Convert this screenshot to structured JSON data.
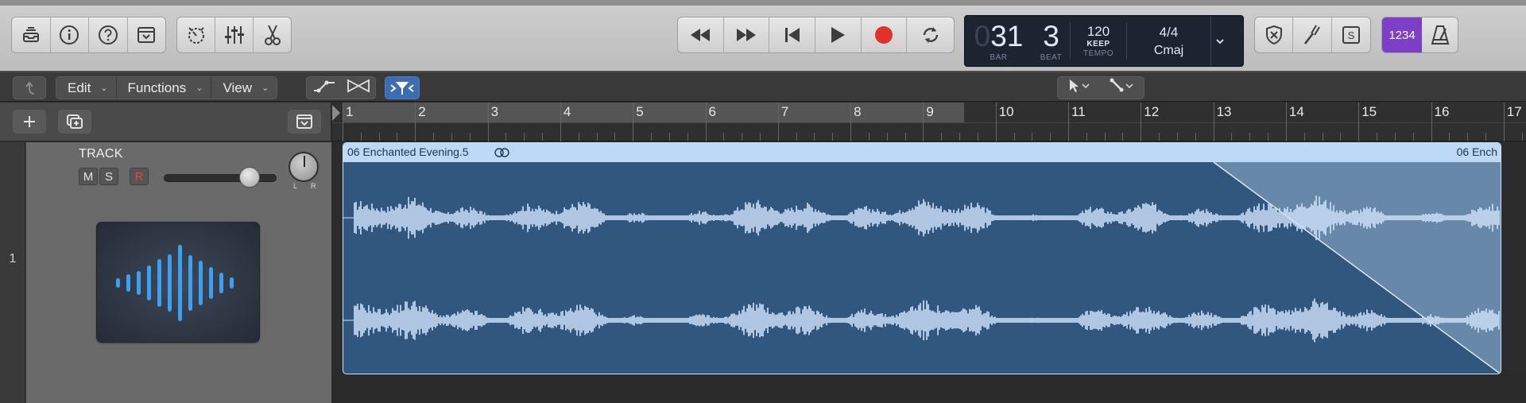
{
  "control_bar": {
    "left_buttons": [
      "library-icon",
      "info-icon",
      "help-icon",
      "toolbar-icon"
    ],
    "mid_buttons": [
      "smart-controls-icon",
      "mixer-icon",
      "editors-scissors-icon"
    ],
    "transport": [
      "rewind-icon",
      "fast-forward-icon",
      "go-to-beginning-icon",
      "play-icon",
      "record-icon",
      "cycle-icon"
    ],
    "right_buttons": [
      "replace-icon",
      "tuner-icon",
      "solo-icon"
    ],
    "record_color": "#e0312b",
    "accent_color": "#7e3fc7"
  },
  "lcd": {
    "bar_dim": "0",
    "bar": "31",
    "beat": "3",
    "bar_label": "BAR",
    "beat_label": "BEAT",
    "tempo": "120",
    "tempo_mode": "KEEP",
    "tempo_label": "TEMPO",
    "time_signature": "4/4",
    "key": "Cmaj"
  },
  "count_in": {
    "label": "1234"
  },
  "toolbar": {
    "menus": [
      {
        "label": "Edit"
      },
      {
        "label": "Functions"
      },
      {
        "label": "View"
      }
    ]
  },
  "ruler": {
    "bars": [
      "1",
      "2",
      "3",
      "4",
      "5",
      "6",
      "7",
      "8",
      "9",
      "10",
      "11",
      "12",
      "13",
      "14",
      "15",
      "16",
      "17"
    ]
  },
  "track": {
    "number": "1",
    "name": "TRACK",
    "mute": "M",
    "solo": "S",
    "record": "R",
    "pan_left": "L",
    "pan_right": "R",
    "volume": 0.76
  },
  "region": {
    "name": "06 Enchanted Evening.5",
    "name_right": "06 Ench",
    "header_color": "#bcdaf7",
    "body_color": "#31577f",
    "wave_color": "#cfe3fa"
  }
}
